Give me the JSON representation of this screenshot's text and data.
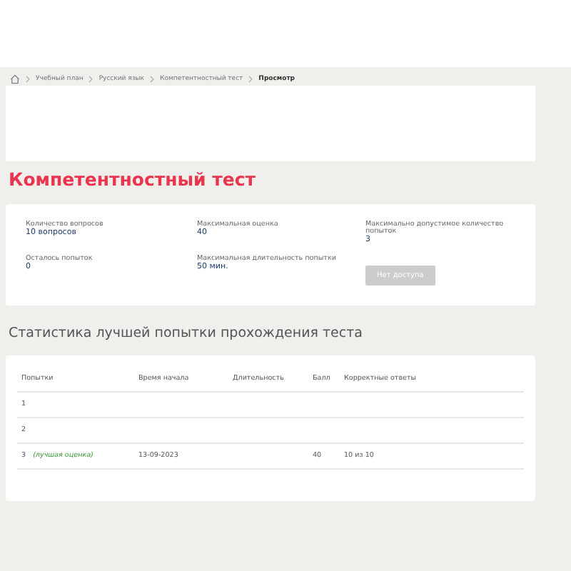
{
  "breadcrumbs": [
    {
      "label": "Учебный план",
      "current": false
    },
    {
      "label": "Русский язык",
      "current": false
    },
    {
      "label": "Компетентностный тест",
      "current": false
    },
    {
      "label": "Просмотр",
      "current": true
    }
  ],
  "title": "Компетентностный тест",
  "info": [
    {
      "label": "Количество вопросов",
      "value": "10 вопросов"
    },
    {
      "label": "Максимальная оценка",
      "value": "40"
    },
    {
      "label": "Максимально допустимое количество попыток",
      "value": "3"
    },
    {
      "label": "Осталось попыток",
      "value": "0"
    },
    {
      "label": "Максимальная длительность попытки",
      "value": "50 мин."
    }
  ],
  "start_button": {
    "label": "Нет доступа",
    "disabled": true
  },
  "stats_heading": "Статистика лучшей попытки прохождения теста",
  "table": {
    "columns": [
      "Попытки",
      "Время начала",
      "Длительность",
      "Балл",
      "Корректные ответы"
    ],
    "rows": [
      {
        "attempt": "1",
        "best_tag": "",
        "start": "",
        "duration": "",
        "score": "",
        "correct": ""
      },
      {
        "attempt": "2",
        "best_tag": "",
        "start": "",
        "duration": "",
        "score": "",
        "correct": ""
      },
      {
        "attempt": "3",
        "best_tag": "(лучшая оценка)",
        "start": "13-09-2023",
        "duration": "",
        "score": "40",
        "correct": "10 из 10"
      }
    ]
  }
}
